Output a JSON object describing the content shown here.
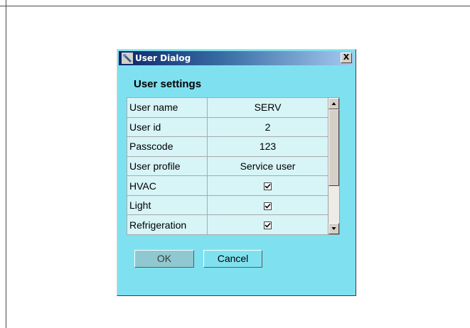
{
  "dialog": {
    "title": "User Dialog",
    "close_label": "X",
    "section_title": "User settings",
    "rows": [
      {
        "label": "User name",
        "value": "SERV"
      },
      {
        "label": "User id",
        "value": "2"
      },
      {
        "label": "Passcode",
        "value": "123"
      },
      {
        "label": "User profile",
        "value": "Service user"
      }
    ],
    "permissions": [
      {
        "label": "HVAC",
        "checked": true
      },
      {
        "label": "Light",
        "checked": true
      },
      {
        "label": "Refrigeration",
        "checked": true
      }
    ],
    "ok_label": "OK",
    "cancel_label": "Cancel"
  },
  "colors": {
    "dialog_bg": "#7fe1f0",
    "row_bg": "#d7f4f7",
    "titlebar_start": "#0a246a",
    "titlebar_end": "#a6caf0"
  }
}
